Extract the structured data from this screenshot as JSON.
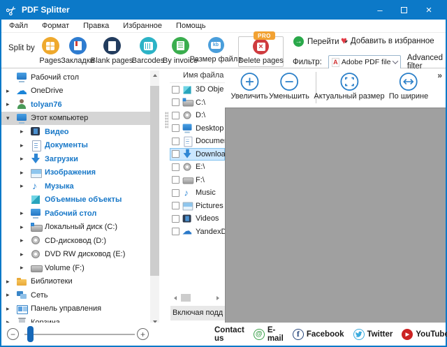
{
  "window": {
    "title": "PDF Splitter"
  },
  "menu": {
    "items": [
      {
        "label": "Файл"
      },
      {
        "label": "Формат"
      },
      {
        "label": "Правка"
      },
      {
        "label": "Избранное"
      },
      {
        "label": "Помощь"
      }
    ]
  },
  "toolbar": {
    "split_by_label": "Split by",
    "buttons": [
      {
        "label": "Pages",
        "icon": "pages-grid-icon",
        "color": "#efa92d"
      },
      {
        "label": "Закладки",
        "icon": "bookmark-icon",
        "color": "#2e7cd0"
      },
      {
        "label": "Blank pages",
        "icon": "blank-page-icon",
        "color": "#223c5e"
      },
      {
        "label": "Barcodes",
        "icon": "barcode-icon",
        "color": "#2cb3c6"
      },
      {
        "label": "By invoice",
        "icon": "invoice-icon",
        "color": "#3aae4e"
      },
      {
        "label": "Размер файла",
        "icon": "file-size-kb-icon",
        "color": "#4a9edb"
      },
      {
        "label": "Delete pages",
        "icon": "delete-x-icon",
        "color": "#cf3b3f",
        "badge": "PRO",
        "selected": true
      }
    ],
    "goto_label": "Перейти",
    "favorites_label": "Добавить в избранное",
    "filter_label": "Фильтр:",
    "filter_value": "Adobe PDF file (*",
    "advanced_filter_label": "Advanced filter"
  },
  "tree": {
    "items": [
      {
        "label": "Рабочий стол",
        "level": 0,
        "expand": "none",
        "bold": false
      },
      {
        "label": "OneDrive",
        "level": 0,
        "expand": "collapsed",
        "bold": false
      },
      {
        "label": "tolyan76",
        "level": 0,
        "expand": "collapsed",
        "bold": true
      },
      {
        "label": "Этот компьютер",
        "level": 0,
        "expand": "expanded",
        "bold": false,
        "selected": true
      },
      {
        "label": "Видео",
        "level": 1,
        "expand": "collapsed",
        "bold": true
      },
      {
        "label": "Документы",
        "level": 1,
        "expand": "collapsed",
        "bold": true
      },
      {
        "label": "Загрузки",
        "level": 1,
        "expand": "collapsed",
        "bold": true
      },
      {
        "label": "Изображения",
        "level": 1,
        "expand": "collapsed",
        "bold": true
      },
      {
        "label": "Музыка",
        "level": 1,
        "expand": "collapsed",
        "bold": true
      },
      {
        "label": "Объемные объекты",
        "level": 1,
        "expand": "none",
        "bold": true
      },
      {
        "label": "Рабочий стол",
        "level": 1,
        "expand": "collapsed",
        "bold": true
      },
      {
        "label": "Локальный диск (C:)",
        "level": 1,
        "expand": "collapsed",
        "bold": false
      },
      {
        "label": "CD-дисковод (D:)",
        "level": 1,
        "expand": "collapsed",
        "bold": false
      },
      {
        "label": "DVD RW дисковод (E:)",
        "level": 1,
        "expand": "collapsed",
        "bold": false
      },
      {
        "label": "Volume (F:)",
        "level": 1,
        "expand": "collapsed",
        "bold": false
      },
      {
        "label": "Библиотеки",
        "level": 0,
        "expand": "collapsed",
        "bold": false
      },
      {
        "label": "Сеть",
        "level": 0,
        "expand": "collapsed",
        "bold": false
      },
      {
        "label": "Панель управления",
        "level": 0,
        "expand": "collapsed",
        "bold": false
      },
      {
        "label": "Корзина",
        "level": 0,
        "expand": "collapsed",
        "bold": false
      }
    ]
  },
  "file_list": {
    "header": "Имя файла",
    "rows": [
      {
        "label": "3D Obje",
        "checked": false
      },
      {
        "label": "C:\\",
        "checked": false
      },
      {
        "label": "D:\\",
        "checked": false
      },
      {
        "label": "Desktop",
        "checked": false
      },
      {
        "label": "Documen",
        "checked": false
      },
      {
        "label": "Downloa",
        "checked": false,
        "selected": true
      },
      {
        "label": "E:\\",
        "checked": false
      },
      {
        "label": "F:\\",
        "checked": false
      },
      {
        "label": "Music",
        "checked": false
      },
      {
        "label": "Pictures",
        "checked": false
      },
      {
        "label": "Videos",
        "checked": false
      },
      {
        "label": "YandexD",
        "checked": false
      }
    ],
    "footer_label": "Включая подд"
  },
  "preview": {
    "buttons": [
      {
        "label": "Увеличить",
        "icon": "zoom-in-icon"
      },
      {
        "label": "Уменьшить",
        "icon": "zoom-out-icon"
      },
      {
        "label": "Актуальный размер",
        "icon": "actual-size-icon"
      },
      {
        "label": "По ширине",
        "icon": "fit-width-icon"
      }
    ],
    "overflow_icon": "»"
  },
  "footer": {
    "contact_label": "Contact us",
    "links": [
      {
        "label": "E-mail",
        "icon": "email-at-icon",
        "color": "#3aa04a"
      },
      {
        "label": "Facebook",
        "icon": "facebook-f-icon",
        "color": "#29487d"
      },
      {
        "label": "Twitter",
        "icon": "twitter-bird-icon",
        "color": "#3aabde"
      },
      {
        "label": "YouTube",
        "icon": "youtube-play-icon",
        "color": "#cc2222"
      }
    ]
  },
  "colors": {
    "titlebar": "#0c79c8",
    "accent_blue": "#2a7fc8",
    "tree_link_blue": "#1878c8",
    "selected_row_gray": "#d5d5d5",
    "selected_file_blue": "#cbe7ff",
    "preview_gray": "#a0a0a0",
    "pro_badge_orange": "#f2a233"
  }
}
